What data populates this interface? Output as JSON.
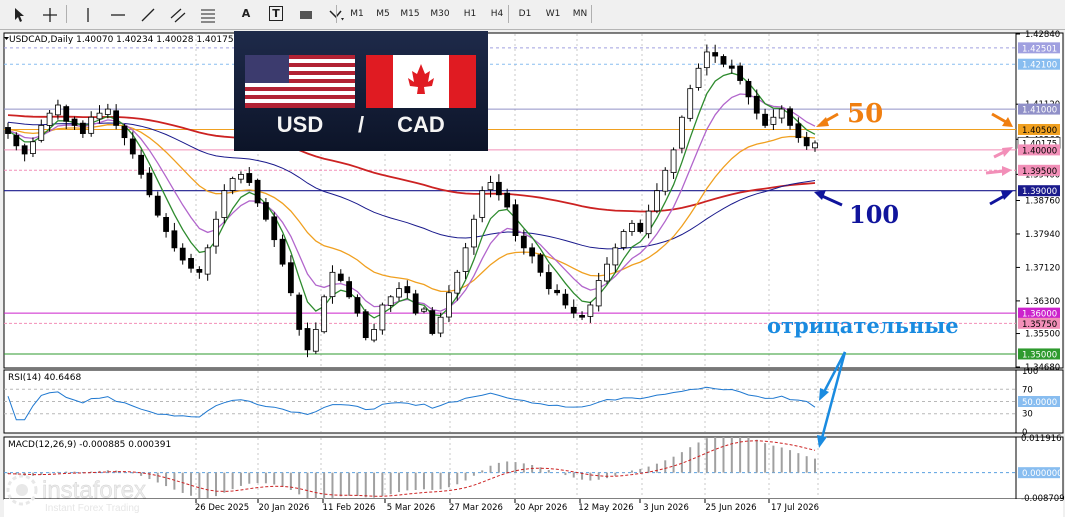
{
  "toolbar": {
    "tools": [
      {
        "name": "cursor-icon"
      },
      {
        "name": "crosshair-icon"
      },
      {
        "name": "vertical-line-icon"
      },
      {
        "name": "horizontal-line-icon"
      },
      {
        "name": "trendline-icon"
      },
      {
        "name": "equidistant-channel-icon"
      },
      {
        "name": "fibonacci-icon"
      },
      {
        "name": "text-icon",
        "label": "A"
      },
      {
        "name": "text-label-icon",
        "label": "T"
      },
      {
        "name": "rectangle-icon"
      },
      {
        "name": "shapes-menu-icon"
      }
    ],
    "timeframes": [
      "M1",
      "M5",
      "M15",
      "M30",
      "H1",
      "H4",
      "D1",
      "W1",
      "MN"
    ]
  },
  "chart_header": "USDCAD,Daily  1.40070 1.40234 1.40028 1.40175",
  "flags": {
    "left": "USD",
    "sep": "/",
    "right": "CAD"
  },
  "annotations": {
    "ma50": "50",
    "ma100": "100",
    "negative": "отрицательные"
  },
  "colors": {
    "ma_fast": "#2e8b2e",
    "ma_mid": "#b266cc",
    "ma50": "#f0a020",
    "ma100": "#1a1a8c",
    "ma200": "#cc2222",
    "candle": "#000000",
    "rsi": "#1f78d0",
    "macd_hist": "#a0a0a0",
    "macd_signal": "#cc2222",
    "annotation_orange": "#f07f10",
    "annotation_navy": "#10149c",
    "annotation_blue": "#1a8be0",
    "annotation_pink": "#f28fb8"
  },
  "price_axis": {
    "ticks": [
      "1.42840",
      "1.41120",
      "1.40260",
      "1.39400",
      "1.38760",
      "1.37940",
      "1.37120",
      "1.36300",
      "1.35500",
      "1.34680"
    ],
    "level_tags": [
      {
        "label": "1.42501",
        "color": "#a0a0e0"
      },
      {
        "label": "1.42100",
        "color": "#88bdf0"
      },
      {
        "label": "1.41000",
        "color": "#9090c8"
      },
      {
        "label": "1.40500",
        "color": "#f0a020"
      },
      {
        "label": "1.40175",
        "color": "#ffffff"
      },
      {
        "label": "1.40000",
        "color": "#f28fb8"
      },
      {
        "label": "1.39500",
        "color": "#f28fb8"
      },
      {
        "label": "1.39000",
        "color": "#1a1a8c"
      },
      {
        "label": "1.36000",
        "color": "#cc22cc"
      },
      {
        "label": "1.35750",
        "color": "#f28fb8"
      },
      {
        "label": "1.35000",
        "color": "#2e9a2e"
      }
    ]
  },
  "rsi": {
    "label": "RSI(14) 40.6468",
    "ticks": [
      "100",
      "70",
      "30",
      "0"
    ],
    "tag": "50.0000"
  },
  "macd": {
    "label": "MACD(12,26,9) -0.000885 0.000391",
    "ticks": [
      "0.011916",
      "-0.008709"
    ],
    "tag": "0.000000"
  },
  "time_axis": [
    "26 Dec 2025",
    "20 Jan 2026",
    "11 Feb 2026",
    "5 Mar 2026",
    "27 Mar 2026",
    "20 Apr 2026",
    "12 May 2026",
    "3 Jun 2026",
    "25 Jun 2026",
    "17 Jul 2026"
  ],
  "watermark": {
    "brand": "instaforex",
    "tagline": "Instant Forex Trading"
  },
  "chart_data": {
    "type": "candlestick",
    "symbol": "USDCAD",
    "timeframe": "Daily",
    "ohlc_last": {
      "open": 1.4007,
      "high": 1.40234,
      "low": 1.40028,
      "close": 1.40175
    },
    "ylim": [
      1.3468,
      1.4284
    ],
    "close_path": [
      1.404,
      1.401,
      1.399,
      1.402,
      1.406,
      1.409,
      1.411,
      1.407,
      1.406,
      1.404,
      1.408,
      1.409,
      1.41,
      1.406,
      1.403,
      1.399,
      1.394,
      1.389,
      1.384,
      1.38,
      1.376,
      1.373,
      1.371,
      1.37,
      1.376,
      1.383,
      1.39,
      1.393,
      1.394,
      1.392,
      1.387,
      1.383,
      1.378,
      1.372,
      1.365,
      1.356,
      1.351,
      1.356,
      1.364,
      1.37,
      1.368,
      1.364,
      1.36,
      1.354,
      1.356,
      1.362,
      1.364,
      1.366,
      1.365,
      1.36,
      1.361,
      1.355,
      1.359,
      1.365,
      1.37,
      1.376,
      1.383,
      1.39,
      1.392,
      1.389,
      1.386,
      1.379,
      1.376,
      1.374,
      1.37,
      1.366,
      1.365,
      1.362,
      1.36,
      1.359,
      1.362,
      1.368,
      1.372,
      1.376,
      1.38,
      1.382,
      1.38,
      1.385,
      1.39,
      1.395,
      1.4,
      1.408,
      1.415,
      1.42,
      1.424,
      1.423,
      1.421,
      1.42,
      1.417,
      1.413,
      1.409,
      1.406,
      1.408,
      1.41,
      1.406,
      1.403,
      1.401,
      1.4017
    ],
    "indicators": {
      "ma_fast": "green",
      "ma_mid": "purple",
      "ma50": "orange",
      "ma100": "navy",
      "ma200": "red",
      "rsi_period": 14,
      "rsi_value": 40.6468,
      "macd_params": [
        12,
        26,
        9
      ],
      "macd_main": -0.000885,
      "macd_signal": 0.000391
    },
    "horizontal_levels": [
      1.425,
      1.421,
      1.41,
      1.405,
      1.4,
      1.395,
      1.39,
      1.36,
      1.3575,
      1.35
    ],
    "rsi_ylim": [
      0,
      100
    ],
    "macd_ylim": [
      -0.008709,
      0.011916
    ]
  }
}
